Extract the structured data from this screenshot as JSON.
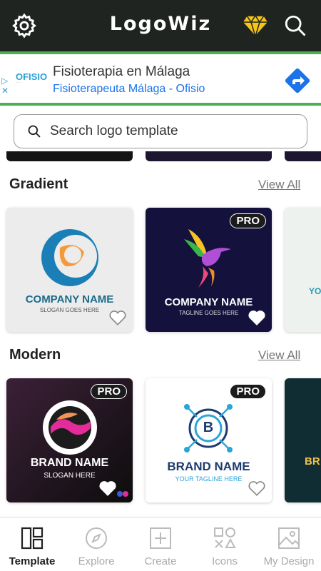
{
  "app": {
    "title": "LogoWiz"
  },
  "header": {
    "settings_icon": "gear-icon",
    "premium_icon": "diamond-icon",
    "search_icon": "search-icon"
  },
  "ad": {
    "brand": "OFISIO",
    "headline": "Fisioterapia en Málaga",
    "subline": "Fisioterapeuta Málaga - Ofisio",
    "colors": {
      "border": "#4caf50",
      "link": "#1a73e8"
    }
  },
  "search": {
    "placeholder": "Search logo template"
  },
  "sections": [
    {
      "title": "Gradient",
      "view_all": "View All",
      "cards": [
        {
          "brand": "COMPANY NAME",
          "tagline": "SLOGAN GOES HERE",
          "pro": false
        },
        {
          "brand": "COMPANY NAME",
          "tagline": "TAGLINE GOES HERE",
          "pro": true,
          "pro_label": "PRO"
        },
        {
          "brand": "YO",
          "partial": true
        }
      ]
    },
    {
      "title": "Modern",
      "view_all": "View All",
      "cards": [
        {
          "brand": "BRAND NAME",
          "tagline": "SLOGAN HERE",
          "pro": true,
          "pro_label": "PRO"
        },
        {
          "brand": "BRAND NAME",
          "tagline": "YOUR TAGLINE HERE",
          "pro": true,
          "pro_label": "PRO",
          "letter": "B"
        },
        {
          "brand": "BR",
          "partial": true
        }
      ]
    }
  ],
  "bottom_nav": [
    {
      "label": "Template",
      "icon": "template-icon",
      "active": true
    },
    {
      "label": "Explore",
      "icon": "compass-icon",
      "active": false
    },
    {
      "label": "Create",
      "icon": "plus-square-icon",
      "active": false
    },
    {
      "label": "Icons",
      "icon": "shapes-icon",
      "active": false
    },
    {
      "label": "My Design",
      "icon": "image-icon",
      "active": false
    }
  ],
  "colors": {
    "header_bg": "#1f2421",
    "accent_gold": "#f5c518"
  }
}
